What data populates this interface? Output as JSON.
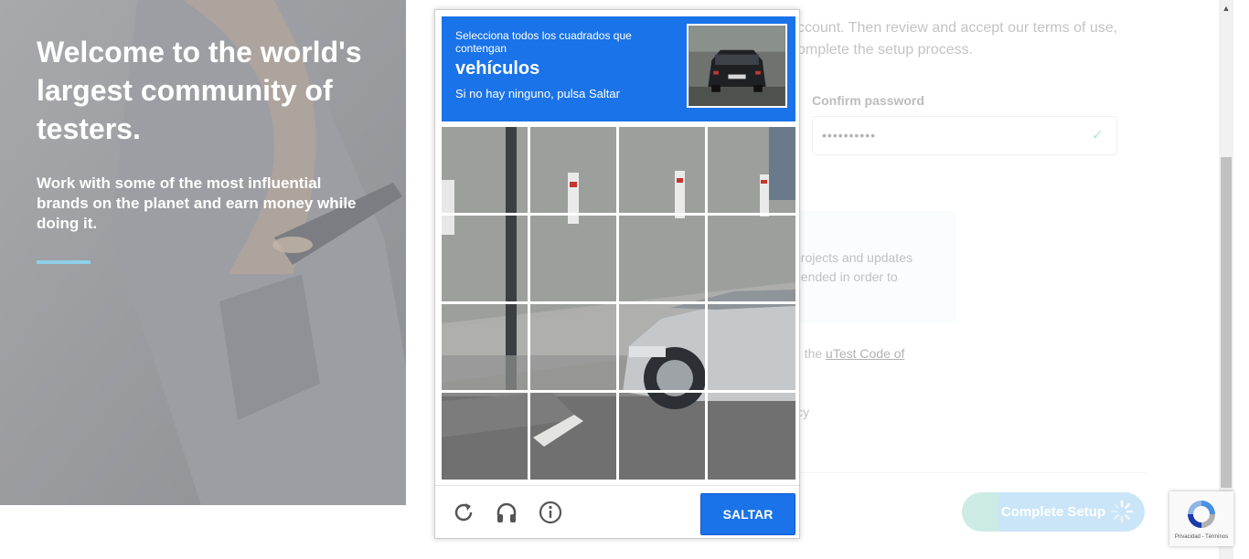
{
  "hero": {
    "title": "Welcome to the world's largest community of testers.",
    "subtitle": "Work with some of the most influential brands on the planet and earn money while doing it."
  },
  "form": {
    "intro": "ccount. Then review and accept our terms of use, omplete the setup process.",
    "confirm_password_label": "Confirm password",
    "confirm_password_value": "••••••••••",
    "info_text": "projects and updates hended in order to",
    "code_prefix": "d the ",
    "code_link": "uTest Code of",
    "policy_text": "icy",
    "complete_setup_label": "Complete Setup"
  },
  "captcha": {
    "instruction": "Selecciona todos los cuadrados que contengan",
    "keyword": "vehículos",
    "hint": "Si no hay ninguno, pulsa Saltar",
    "skip_label": "SALTAR",
    "grid_rows": 4,
    "grid_cols": 4
  },
  "recaptcha_badge": {
    "links": "Privacidad - Términos"
  },
  "colors": {
    "captcha_blue": "#1a73e8",
    "accent_green": "#8fd3c6",
    "accent_blue": "#8ac6ee"
  },
  "icons": [
    "reload-icon",
    "audio-icon",
    "info-icon",
    "check-icon",
    "spinner-icon",
    "recaptcha-logo-icon"
  ]
}
